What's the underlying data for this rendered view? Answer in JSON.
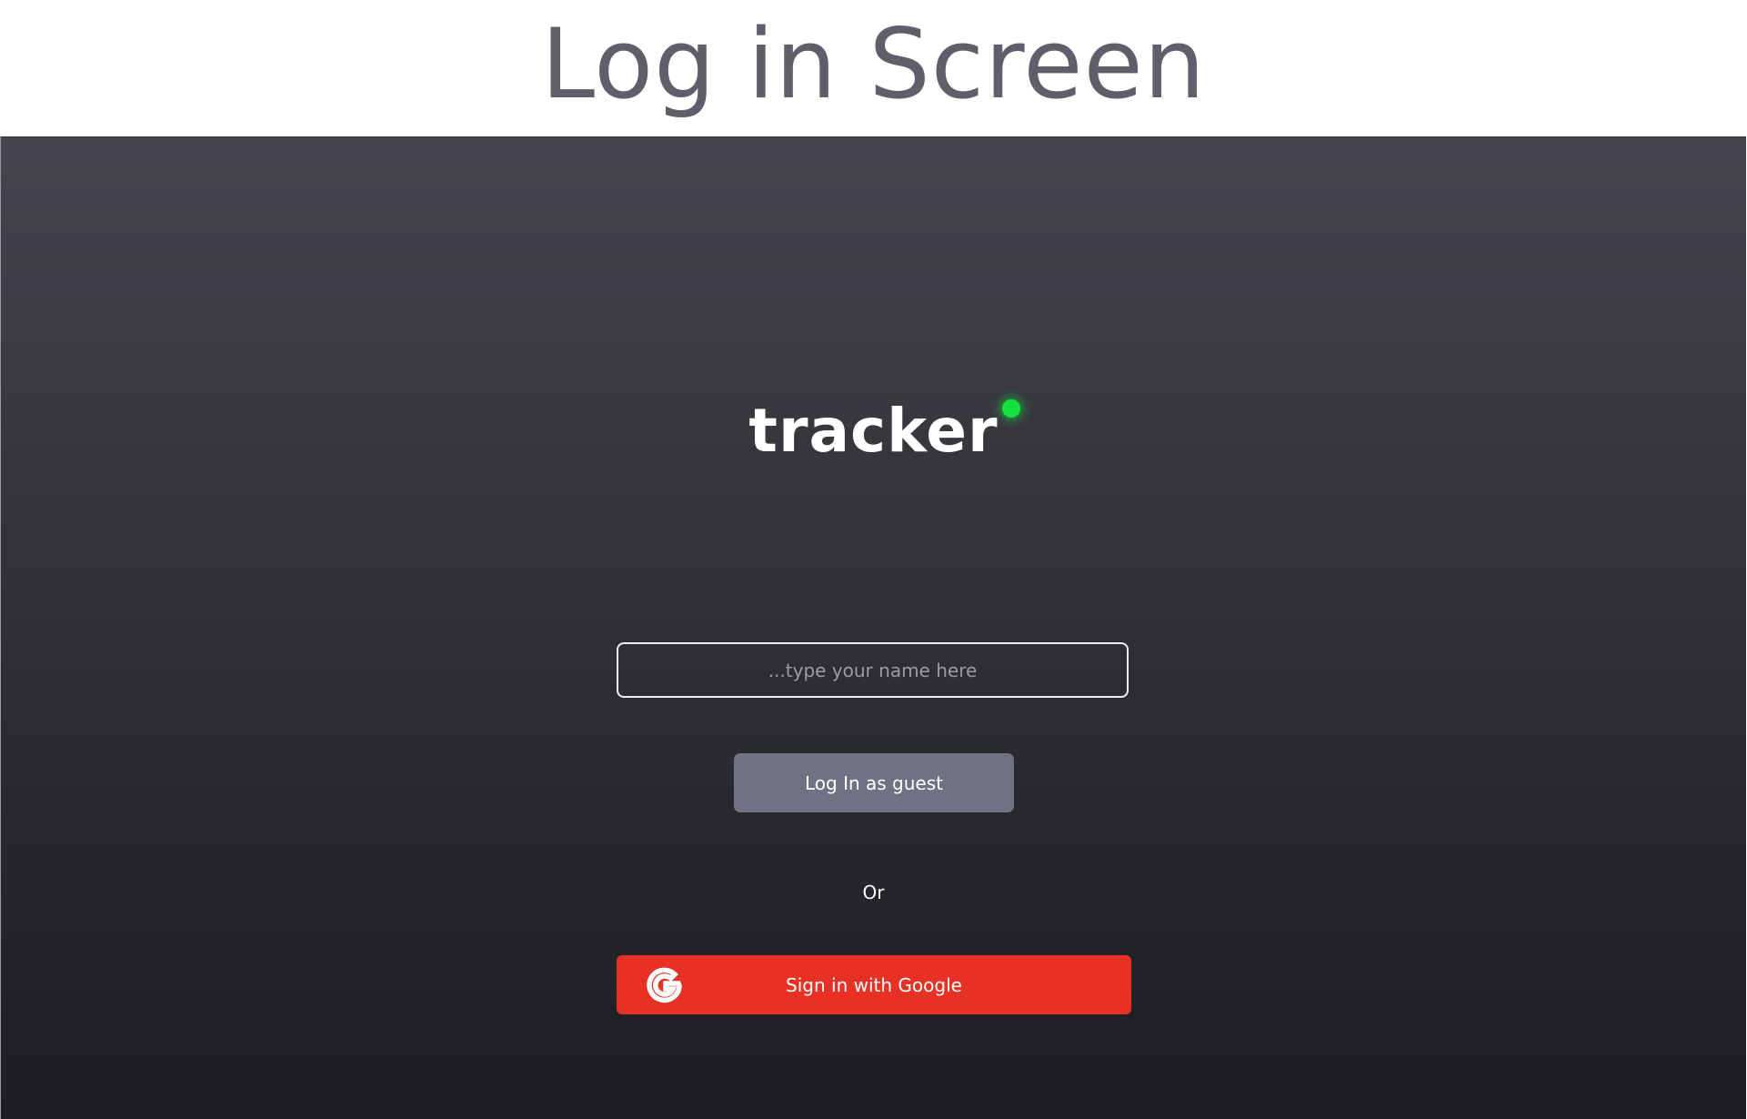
{
  "header": {
    "title": "Log in Screen"
  },
  "app": {
    "logo_text": "tracker",
    "status_dot_color": "#14e23c"
  },
  "login": {
    "name_placeholder": "...type your name here",
    "name_value": "",
    "guest_button_label": "Log In as guest",
    "separator_text": "Or",
    "google_button_label": "Sign in with Google",
    "google_icon": "google-g-icon"
  },
  "colors": {
    "background_top": "#45454d",
    "background_bottom": "#1d1d22",
    "guest_button": "#707182",
    "google_button": "#e73125",
    "title_text": "#5f5e6b"
  }
}
